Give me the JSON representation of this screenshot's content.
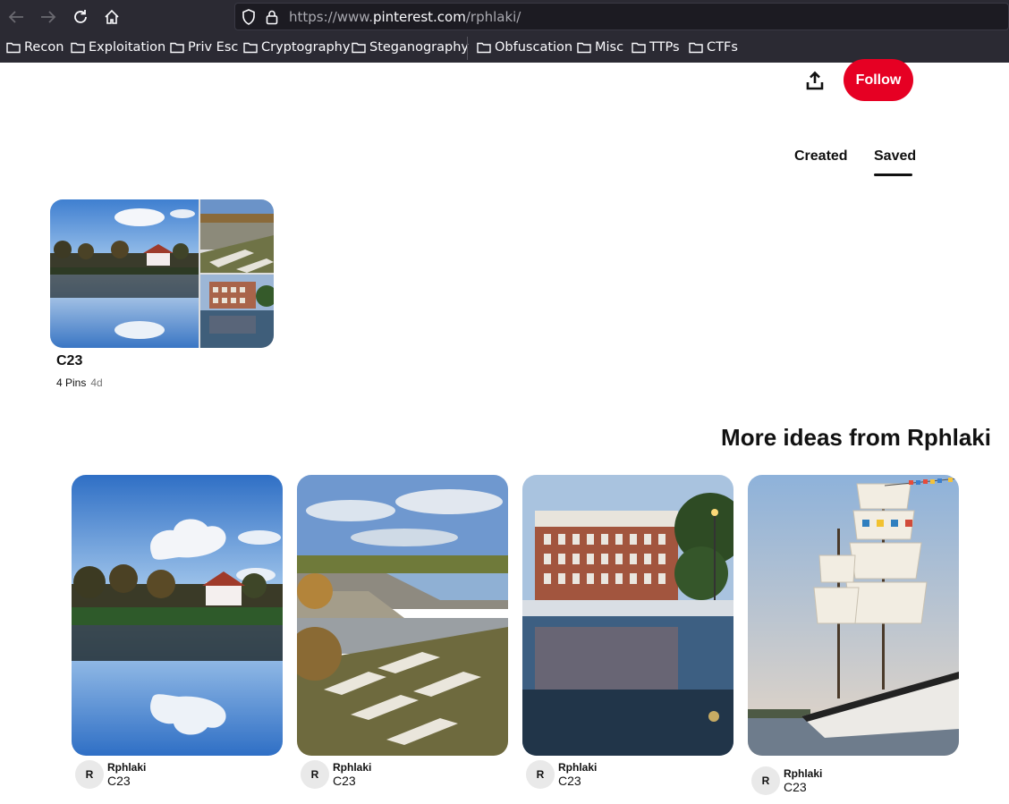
{
  "browser": {
    "url_prefix": "https://www.",
    "url_host": "pinterest.com",
    "url_path": "/rphlaki/",
    "bookmarks": [
      "Recon",
      "Exploitation",
      "Priv Esc",
      "Cryptography",
      "Steganography",
      "Obfuscation",
      "Misc",
      "TTPs",
      "CTFs"
    ]
  },
  "profile": {
    "follow_label": "Follow",
    "tabs": [
      "Created",
      "Saved"
    ],
    "active_tab": "Saved"
  },
  "board": {
    "title": "C23",
    "pins": "4 Pins",
    "age": "4d"
  },
  "more": {
    "title": "More ideas from Rphlaki",
    "pins": [
      {
        "avatar": "R",
        "user": "Rphlaki",
        "board": "C23"
      },
      {
        "avatar": "R",
        "user": "Rphlaki",
        "board": "C23"
      },
      {
        "avatar": "R",
        "user": "Rphlaki",
        "board": "C23"
      },
      {
        "avatar": "R",
        "user": "Rphlaki",
        "board": "C23"
      }
    ]
  },
  "colors": {
    "accent": "#e60023",
    "chrome": "#2b2a33"
  }
}
